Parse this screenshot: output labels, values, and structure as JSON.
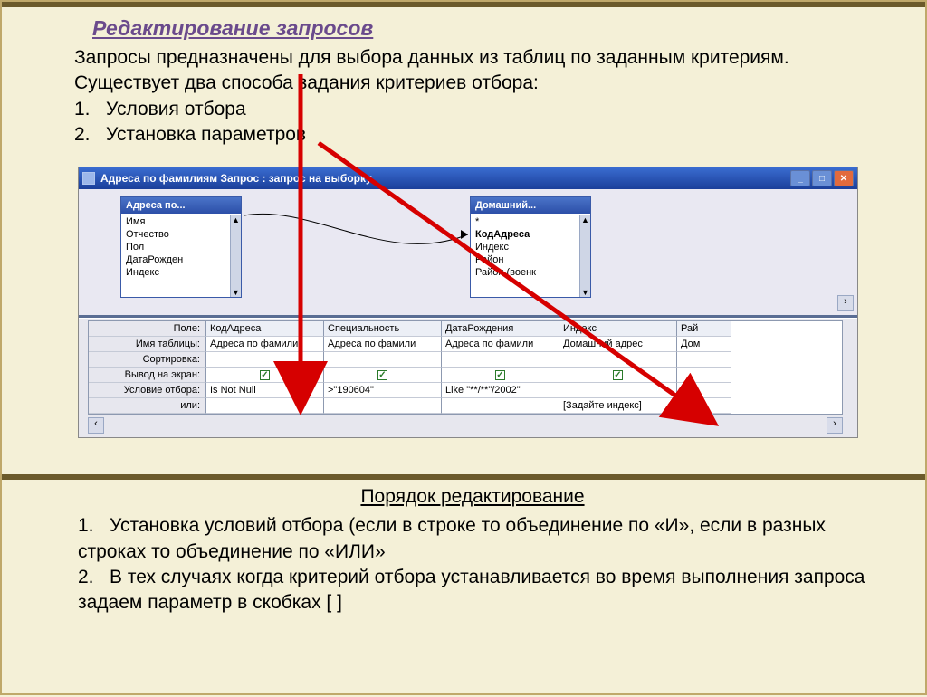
{
  "title": "Редактирование запросов",
  "intro": {
    "text": "Запросы предназначены для выбора данных из таблиц по заданным критериям. Существует два способа задания критериев отбора:",
    "item1": "Условия отбора",
    "item2": "Установка параметров"
  },
  "window": {
    "title": "Адреса по фамилиям Запрос : запрос на выборку",
    "table1": {
      "header": "Адреса по...",
      "items": [
        "Имя",
        "Отчество",
        "Пол",
        "ДатаРожден",
        "Индекс"
      ]
    },
    "table2": {
      "header": "Домашний...",
      "items": [
        "*",
        "КодАдреса",
        "Индекс",
        "Район",
        "Район (военк"
      ]
    },
    "grid": {
      "row_labels": [
        "Поле:",
        "Имя таблицы:",
        "Сортировка:",
        "Вывод на экран:",
        "Условие отбора:",
        "или:"
      ],
      "cols": [
        {
          "field": "КодАдреса",
          "table": "Адреса по фамили",
          "show": true,
          "cond": "Is Not Null",
          "or": ""
        },
        {
          "field": "Специальность",
          "table": "Адреса по фамили",
          "show": true,
          "cond": ">\"190604\"",
          "or": ""
        },
        {
          "field": "ДатаРождения",
          "table": "Адреса по фамили",
          "show": true,
          "cond": "Like \"**/**\"/2002\"",
          "or": ""
        },
        {
          "field": "Индекс",
          "table": "Домашний адрес",
          "show": true,
          "cond": "",
          "or": "[Задайте индекс]"
        },
        {
          "field": "Рай",
          "table": "Дом",
          "show": false,
          "cond": "",
          "or": ""
        }
      ]
    }
  },
  "footer": {
    "title": "Порядок редактирование",
    "item1": "Установка условий отбора (если в строке то объединение по «И», если в разных строках то объединение по «ИЛИ»",
    "item2": "В тех случаях когда критерий отбора устанавливается во время выполнения запроса задаем параметр в скобках [ ]"
  }
}
